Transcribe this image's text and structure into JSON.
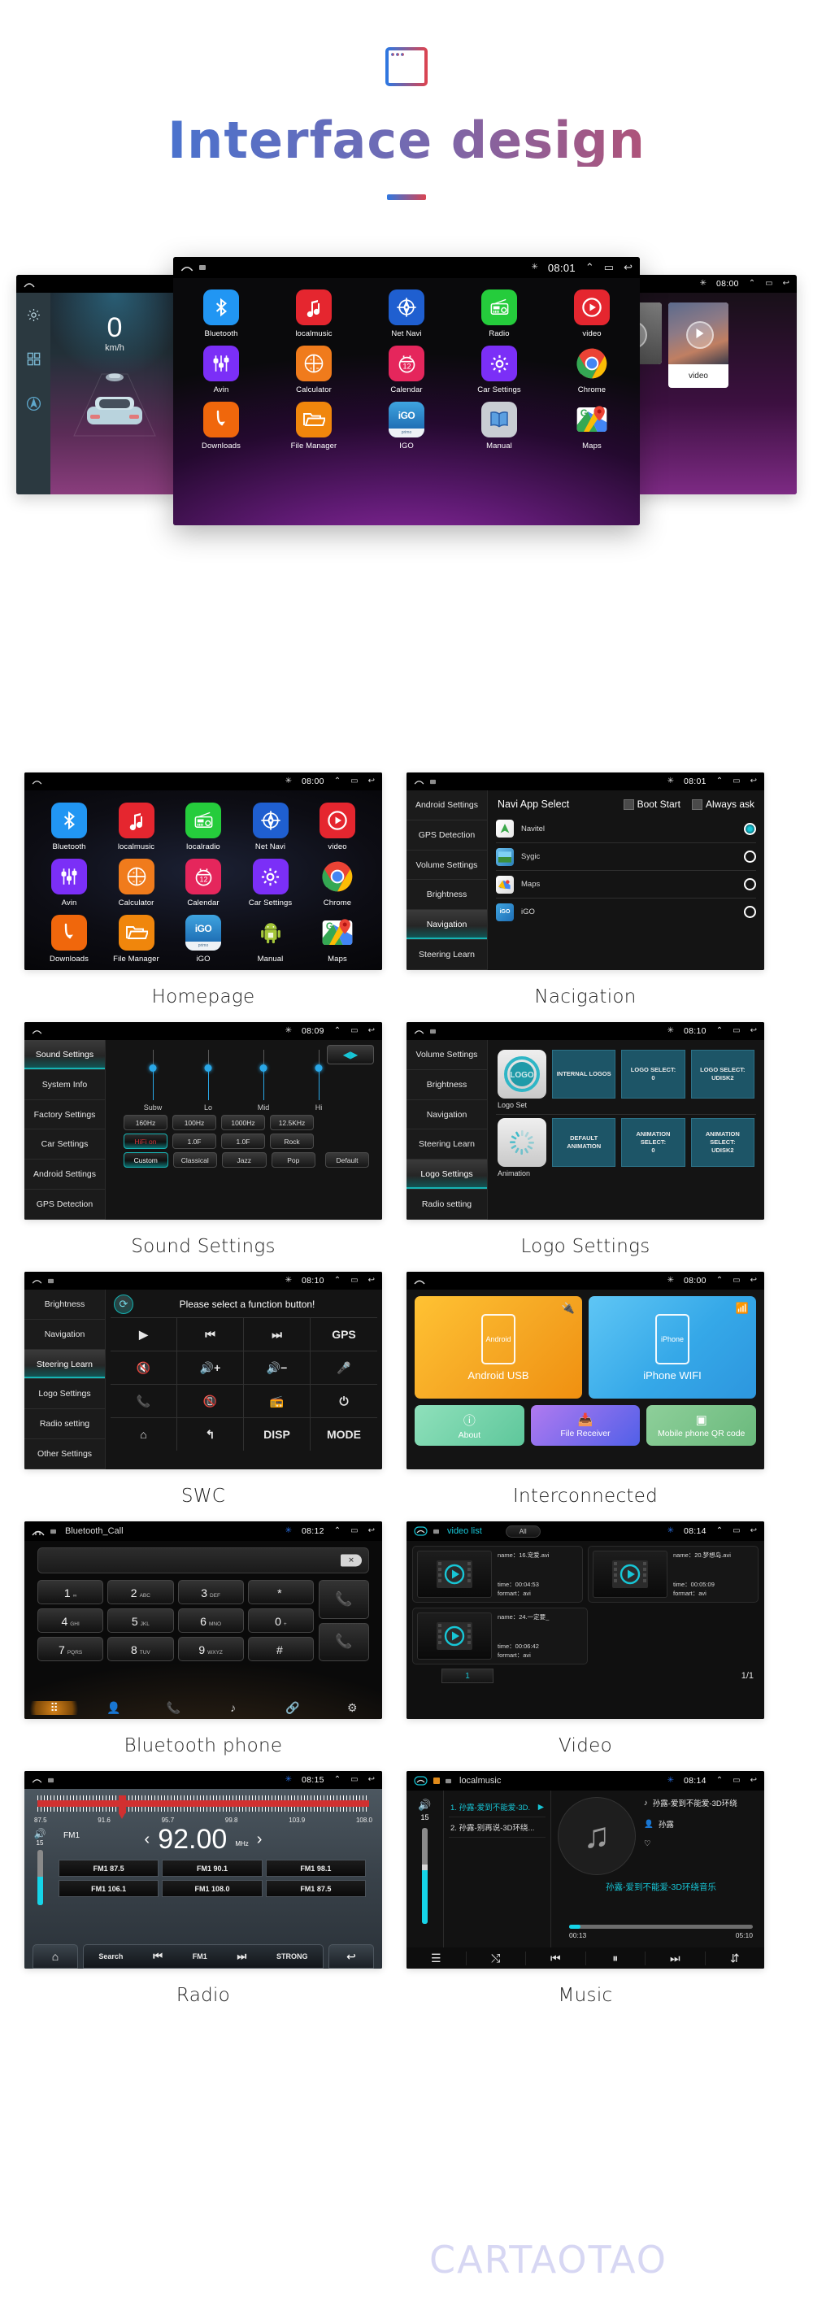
{
  "header": {
    "title": "Interface design",
    "icon": "browser-window-icon",
    "gradient_start": "#2f77e0",
    "gradient_end": "#d94452"
  },
  "hero": {
    "left_screen": {
      "statusbar": {
        "home": "home-icon",
        "time": ""
      },
      "speed_value": "0",
      "speed_unit": "km/h",
      "rail_icons": [
        "gear-icon",
        "apps-grid-icon",
        "navigation-circle-icon"
      ]
    },
    "center_screen": {
      "statusbar": {
        "time": "08:01",
        "bluetooth": "bluetooth-icon"
      },
      "apps": [
        [
          {
            "label": "Bluetooth",
            "icon": "bluetooth-icon",
            "color": "#2196f3"
          },
          {
            "label": "localmusic",
            "icon": "music-note-icon",
            "color": "#e5262f"
          },
          {
            "label": "Net Navi",
            "icon": "compass-icon",
            "color": "#1f5fd0"
          },
          {
            "label": "Radio",
            "icon": "radio-icon",
            "color": "#25cc3c"
          },
          {
            "label": "video",
            "icon": "play-circle-icon",
            "color": "#e5262f"
          }
        ],
        [
          {
            "label": "Avin",
            "icon": "sliders-icon",
            "color": "#7b2ff7"
          },
          {
            "label": "Calculator",
            "icon": "calculator-icon",
            "color": "#f07b1c"
          },
          {
            "label": "Calendar",
            "icon": "calendar-icon",
            "color": "#e5265c"
          },
          {
            "label": "Car Settings",
            "icon": "gear-icon",
            "color": "#7b2ff7"
          },
          {
            "label": "Chrome",
            "icon": "chrome-icon",
            "color": "#ffffff"
          }
        ],
        [
          {
            "label": "Downloads",
            "icon": "download-arrow-icon",
            "color": "#f0670c"
          },
          {
            "label": "File Manager",
            "icon": "folder-icon",
            "color": "#f0860c"
          },
          {
            "label": "IGO",
            "icon": "igo-icon",
            "color": "#2e86c8"
          },
          {
            "label": "Manual",
            "icon": "book-icon",
            "color": "#c9cdd3"
          },
          {
            "label": "Maps",
            "icon": "google-maps-icon",
            "color": "#ffffff"
          }
        ]
      ]
    },
    "right_screen": {
      "statusbar": {
        "time": "08:00"
      },
      "video_label": "video"
    }
  },
  "cards": [
    {
      "caption": "Homepage",
      "statusbar": {
        "time": "08:00"
      },
      "apps": [
        [
          {
            "label": "Bluetooth",
            "icon": "bluetooth-icon",
            "color": "#2196f3"
          },
          {
            "label": "localmusic",
            "icon": "music-note-icon",
            "color": "#e5262f"
          },
          {
            "label": "localradio",
            "icon": "radio-icon",
            "color": "#25cc3c"
          },
          {
            "label": "Net Navi",
            "icon": "compass-icon",
            "color": "#1f5fd0"
          },
          {
            "label": "video",
            "icon": "play-circle-icon",
            "color": "#e5262f"
          }
        ],
        [
          {
            "label": "Avin",
            "icon": "sliders-icon",
            "color": "#7b2ff7"
          },
          {
            "label": "Calculator",
            "icon": "calculator-icon",
            "color": "#f07b1c"
          },
          {
            "label": "Calendar",
            "icon": "calendar-icon",
            "color": "#e5265c"
          },
          {
            "label": "Car Settings",
            "icon": "gear-icon",
            "color": "#7b2ff7"
          },
          {
            "label": "Chrome",
            "icon": "chrome-icon",
            "color": "#ffffff"
          }
        ],
        [
          {
            "label": "Downloads",
            "icon": "download-arrow-icon",
            "color": "#f0670c"
          },
          {
            "label": "File Manager",
            "icon": "folder-icon",
            "color": "#f0860c"
          },
          {
            "label": "iGO",
            "icon": "igo-icon",
            "color": "#2e86c8"
          },
          {
            "label": "Manual",
            "icon": "android-icon",
            "color": "#141414"
          },
          {
            "label": "Maps",
            "icon": "google-maps-icon",
            "color": "#ffffff"
          }
        ]
      ]
    },
    {
      "caption": "Nacigation",
      "statusbar": {
        "time": "08:01"
      },
      "sidenav": [
        "Android Settings",
        "GPS Detection",
        "Volume Settings",
        "Brightness",
        "Navigation",
        "Steering Learn"
      ],
      "active_nav": "Navigation",
      "panel_title": "Navi App Select",
      "checkboxes": [
        "Boot Start",
        "Always ask"
      ],
      "rows": [
        {
          "name": "Navitel",
          "selected": true
        },
        {
          "name": "Sygic",
          "selected": false
        },
        {
          "name": "Maps",
          "selected": false
        },
        {
          "name": "iGO",
          "selected": false
        }
      ]
    },
    {
      "caption": "Sound Settings",
      "statusbar": {
        "time": "08:09"
      },
      "sidenav": [
        "Sound Settings",
        "System Info",
        "Factory Settings",
        "Car Settings",
        "Android Settings",
        "GPS Detection"
      ],
      "active_nav": "Sound Settings",
      "sliders": [
        "Subw",
        "Lo",
        "Mid",
        "Hi"
      ],
      "freq_row": [
        "160Hz",
        "100Hz",
        "1000Hz",
        "12.5KHz"
      ],
      "gain_row": [
        "HiFi on",
        "1.0F",
        "1.0F",
        "Rock"
      ],
      "preset_row": [
        "Custom",
        "Classical",
        "Jazz",
        "Pop"
      ],
      "default_button": "Default",
      "fader_button": "fader-balance-icon"
    },
    {
      "caption": "Logo Settings",
      "statusbar": {
        "time": "08:10"
      },
      "sidenav": [
        "Volume Settings",
        "Brightness",
        "Navigation",
        "Steering Learn",
        "Logo Settings",
        "Radio setting"
      ],
      "active_nav": "Logo Settings",
      "sections": [
        {
          "thumb_label": "LOGO",
          "caption": "Logo Set",
          "buttons": [
            "INTERNAL LOGOS",
            "LOGO SELECT:\n0",
            "LOGO SELECT:\nUDISK2"
          ]
        },
        {
          "thumb_label": "spinner",
          "caption": "Animation",
          "buttons": [
            "DEFAULT\nANIMATION",
            "ANIMATION\nSELECT:\n0",
            "ANIMATION\nSELECT:\nUDISK2"
          ]
        }
      ]
    },
    {
      "caption": "SWC",
      "statusbar": {
        "time": "08:10"
      },
      "sidenav": [
        "Brightness",
        "Navigation",
        "Steering Learn",
        "Logo Settings",
        "Radio setting",
        "Other Settings"
      ],
      "active_nav": "Steering Learn",
      "prompt": "Please select a function button!",
      "buttons": [
        "play-icon",
        "previous-track-icon",
        "next-track-icon",
        "GPS",
        "mute-icon",
        "volume-up-icon",
        "volume-down-icon",
        "microphone-icon",
        "call-answer-icon",
        "call-end-icon",
        "radio-icon",
        "power-icon",
        "home-icon",
        "back-icon",
        "DISP",
        "MODE"
      ]
    },
    {
      "caption": "Interconnected",
      "statusbar": {
        "time": "08:00"
      },
      "big_tiles": [
        {
          "label": "Android USB",
          "phone_text": "Android",
          "corner_icon": "usb-icon",
          "color": "#f5a623"
        },
        {
          "label": "iPhone WIFI",
          "phone_text": "iPhone",
          "corner_icon": "wifi-icon",
          "color": "#35a8e8"
        }
      ],
      "small_tiles": [
        {
          "label": "About",
          "icon": "info-icon"
        },
        {
          "label": "File Receiver",
          "icon": "inbox-download-icon"
        },
        {
          "label": "Mobile phone QR code",
          "icon": "qr-code-icon"
        }
      ]
    },
    {
      "caption": "Bluetooth phone",
      "statusbar": {
        "title": "Bluetooth_Call",
        "time": "08:12"
      },
      "input_value": "",
      "delete_icon": "backspace-icon",
      "keys": [
        {
          "d": "1",
          "s": "∞"
        },
        {
          "d": "2",
          "s": "ABC"
        },
        {
          "d": "3",
          "s": "DEF"
        },
        {
          "d": "*",
          "s": ""
        },
        {
          "d": "4",
          "s": "GHI"
        },
        {
          "d": "5",
          "s": "JKL"
        },
        {
          "d": "6",
          "s": "MNO"
        },
        {
          "d": "0",
          "s": "+"
        },
        {
          "d": "7",
          "s": "PQRS"
        },
        {
          "d": "8",
          "s": "TUV"
        },
        {
          "d": "9",
          "s": "WXYZ"
        },
        {
          "d": "#",
          "s": ""
        }
      ],
      "call_buttons": [
        "call-answer-icon",
        "call-history-icon"
      ],
      "tabs": [
        "dialpad-icon",
        "contacts-icon",
        "call-log-icon",
        "music-icon",
        "link-icon",
        "settings-icon"
      ]
    },
    {
      "caption": "Video",
      "statusbar": {
        "title": "video list",
        "filter": "All",
        "time": "08:14"
      },
      "videos": [
        {
          "name": "name：16.宠爱.avi",
          "time": "time：00:04:53",
          "format": "formart：avi"
        },
        {
          "name": "name：20.梦想岛.avi",
          "time": "time：00:05:09",
          "format": "formart：avi"
        },
        {
          "name": "name：24.一定要_",
          "time": "time：00:06:42",
          "format": "formart：avi"
        }
      ],
      "page_button": "1",
      "page_count": "1/1"
    },
    {
      "caption": "Radio",
      "statusbar": {
        "time": "08:15"
      },
      "scale": [
        "87.5",
        "91.6",
        "95.7",
        "99.8",
        "103.9",
        "108.0"
      ],
      "band": "FM1",
      "frequency": "92.00",
      "unit": "MHz",
      "volume": "15",
      "presets": [
        "FM1 87.5",
        "FM1 90.1",
        "FM1 98.1",
        "FM1 106.1",
        "FM1 108.0",
        "FM1 87.5"
      ],
      "bottom": [
        "home-icon",
        "Search",
        "previous-icon",
        "FM1",
        "next-icon",
        "STRONG",
        "back-icon"
      ]
    },
    {
      "caption": "Music",
      "statusbar": {
        "title": "localmusic",
        "time": "08:14"
      },
      "volume": "15",
      "playlist": [
        "1. 孙露-爱到不能爱-3D.",
        "2. 孙露-别再说-3D环绕..."
      ],
      "track_title": "孙露-爱到不能爱-3D环绕",
      "artist": "孙露",
      "favorite_icon": "heart-icon",
      "now_playing": "孙露-爱到不能爱-3D环绕音乐",
      "elapsed": "00:13",
      "duration": "05:10",
      "controls": [
        "playlist-icon",
        "shuffle-icon",
        "previous-track-icon",
        "pause-icon",
        "next-track-icon",
        "equalizer-icon"
      ]
    }
  ],
  "watermark": "CARTAOTAO"
}
